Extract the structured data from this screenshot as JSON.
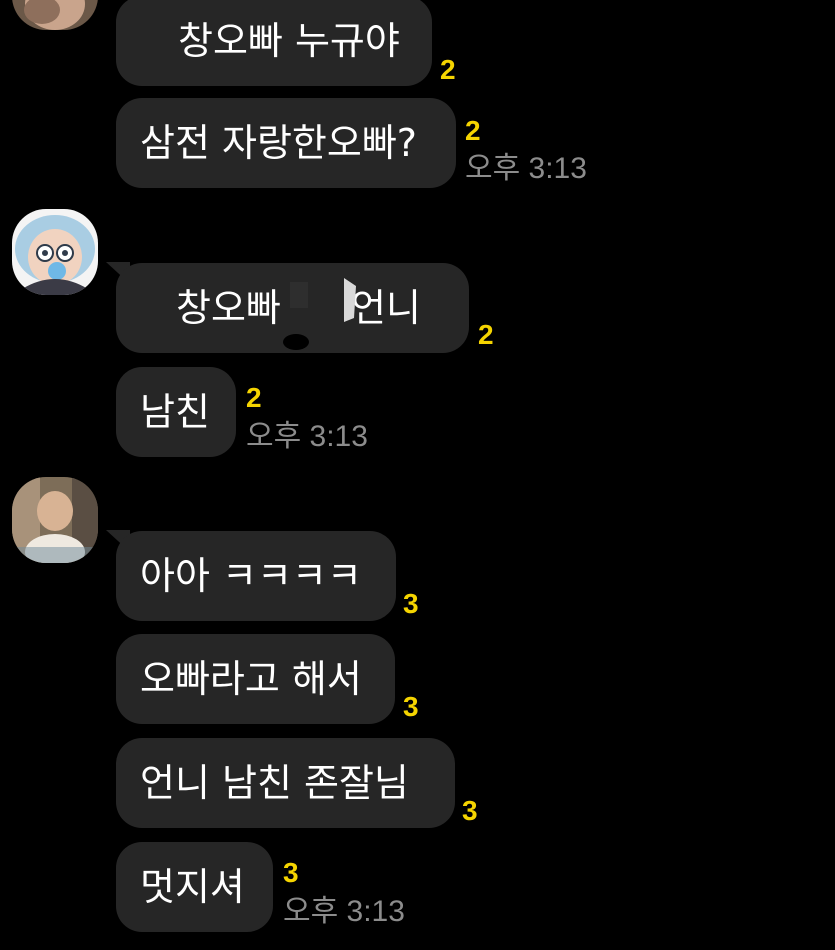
{
  "colors": {
    "background": "#000000",
    "bubble": "#262626",
    "text": "#ffffff",
    "unread": "#f5d400",
    "time": "#8c8c8c"
  },
  "groups": [
    {
      "avatar": "partial-profile-avatar",
      "messages": [
        {
          "text": "창오빠 누규야",
          "unread": "2"
        },
        {
          "text": "삼전 자랑한오빠?",
          "unread": "2",
          "time": "오후 3:13"
        }
      ]
    },
    {
      "avatar": "cartoon-girl-avatar",
      "messages": [
        {
          "text_before": "창오빠",
          "text_after": "언니",
          "unread": "2"
        },
        {
          "text": "남친",
          "unread": "2",
          "time": "오후 3:13"
        }
      ]
    },
    {
      "avatar": "photo-woman-avatar",
      "messages": [
        {
          "text": "아아 ㅋㅋㅋㅋ",
          "unread": "3"
        },
        {
          "text": "오빠라고 해서",
          "unread": "3"
        },
        {
          "text": "언니 남친 존잘님",
          "unread": "3"
        },
        {
          "text": "멋지셔",
          "unread": "3",
          "time": "오후 3:13"
        }
      ]
    }
  ]
}
